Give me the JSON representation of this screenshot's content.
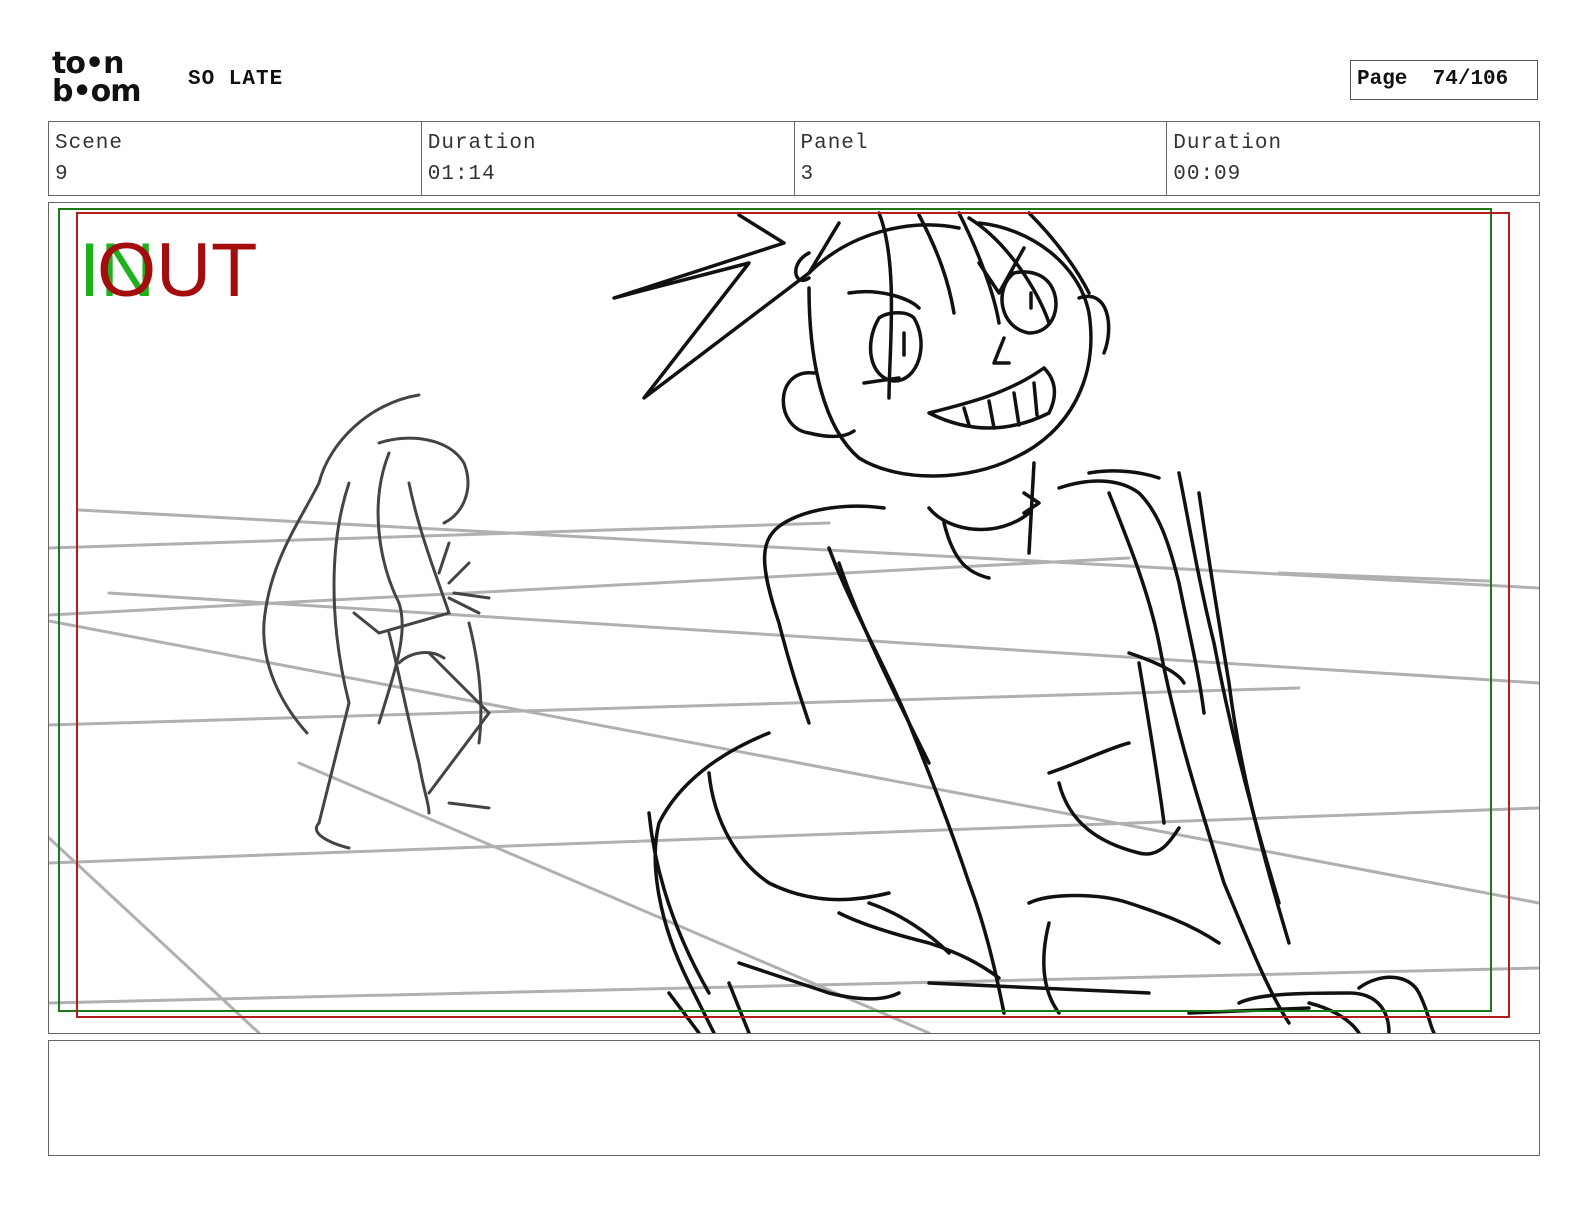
{
  "header": {
    "logo_text": "to•n\nb•om",
    "project_title": "SO LATE",
    "page_label": "Page",
    "page_number": "74/106"
  },
  "info": {
    "scene_label": "Scene",
    "scene_value": "9",
    "scene_duration_label": "Duration",
    "scene_duration_value": "01:14",
    "panel_label": "Panel",
    "panel_value": "3",
    "panel_duration_label": "Duration",
    "panel_duration_value": "00:09"
  },
  "panel": {
    "in_marker": "IN",
    "out_marker": "OUT",
    "in_frame_color": "#1a7a1a",
    "out_frame_color": "#b21e1e",
    "sketch_color": "#111111",
    "background_character_color": "#444444",
    "floor_grid_color": "#b0b0b0"
  },
  "notes": {
    "text": ""
  }
}
